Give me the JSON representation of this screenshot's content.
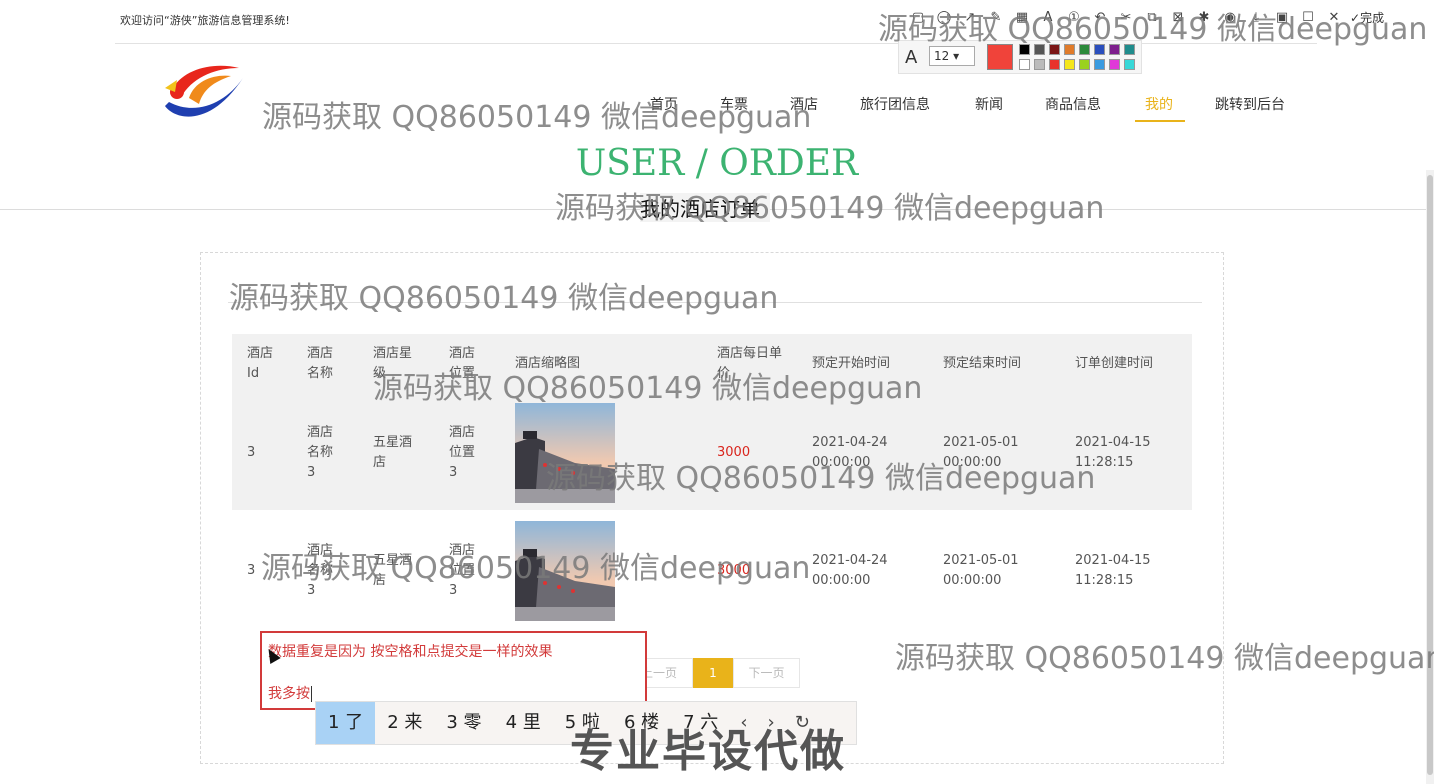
{
  "header": {
    "welcome": "欢迎访问“游侠”旅游信息管理系统!",
    "nav": [
      {
        "label": "首页"
      },
      {
        "label": "车票"
      },
      {
        "label": "酒店"
      },
      {
        "label": "旅行团信息"
      },
      {
        "label": "新闻"
      },
      {
        "label": "商品信息"
      },
      {
        "label": "我的",
        "active": true
      },
      {
        "label": "跳转到后台"
      }
    ],
    "banner_title": "USER / ORDER",
    "sub_title": "我的酒店订单"
  },
  "table": {
    "headers": [
      "酒店Id",
      "酒店名称",
      "酒店星级",
      "酒店位置",
      "酒店缩略图",
      "酒店每日单价",
      "预定开始时间",
      "预定结束时间",
      "订单创建时间"
    ],
    "rows": [
      {
        "id": "3",
        "name": "酒店名称3",
        "star": "五星酒店",
        "location": "酒店位置3",
        "price": "3000",
        "start": "2021-04-24 00:00:00",
        "end": "2021-05-01 00:00:00",
        "created": "2021-04-15 11:28:15"
      },
      {
        "id": "3",
        "name": "酒店名称3",
        "star": "五星酒店",
        "location": "酒店位置3",
        "price": "3000",
        "start": "2021-04-24 00:00:00",
        "end": "2021-05-01 00:00:00",
        "created": "2021-04-15 11:28:15"
      }
    ]
  },
  "pagination": {
    "prev": "上一页",
    "current": "1",
    "next": "下一页"
  },
  "annotation": {
    "line1": "数据重复是因为 按空格和点提交是一样的效果",
    "line2": "我多按"
  },
  "ime": {
    "candidates": [
      "1 了",
      "2 来",
      "3 零",
      "4 里",
      "5 啦",
      "6 楼",
      "7 六"
    ],
    "controls": [
      "‹",
      "›",
      "↻"
    ]
  },
  "screenshot_tool": {
    "font_size": "12",
    "done": "完成",
    "accent": "#f0433a"
  },
  "watermark": {
    "text": "源码获取 QQ86050149 微信deepguan",
    "big": "专业毕设代做"
  },
  "colors": {
    "accent": "#e9b31a",
    "title": "#3cb371",
    "price": "#d9251d",
    "note": "#d23a3a"
  }
}
